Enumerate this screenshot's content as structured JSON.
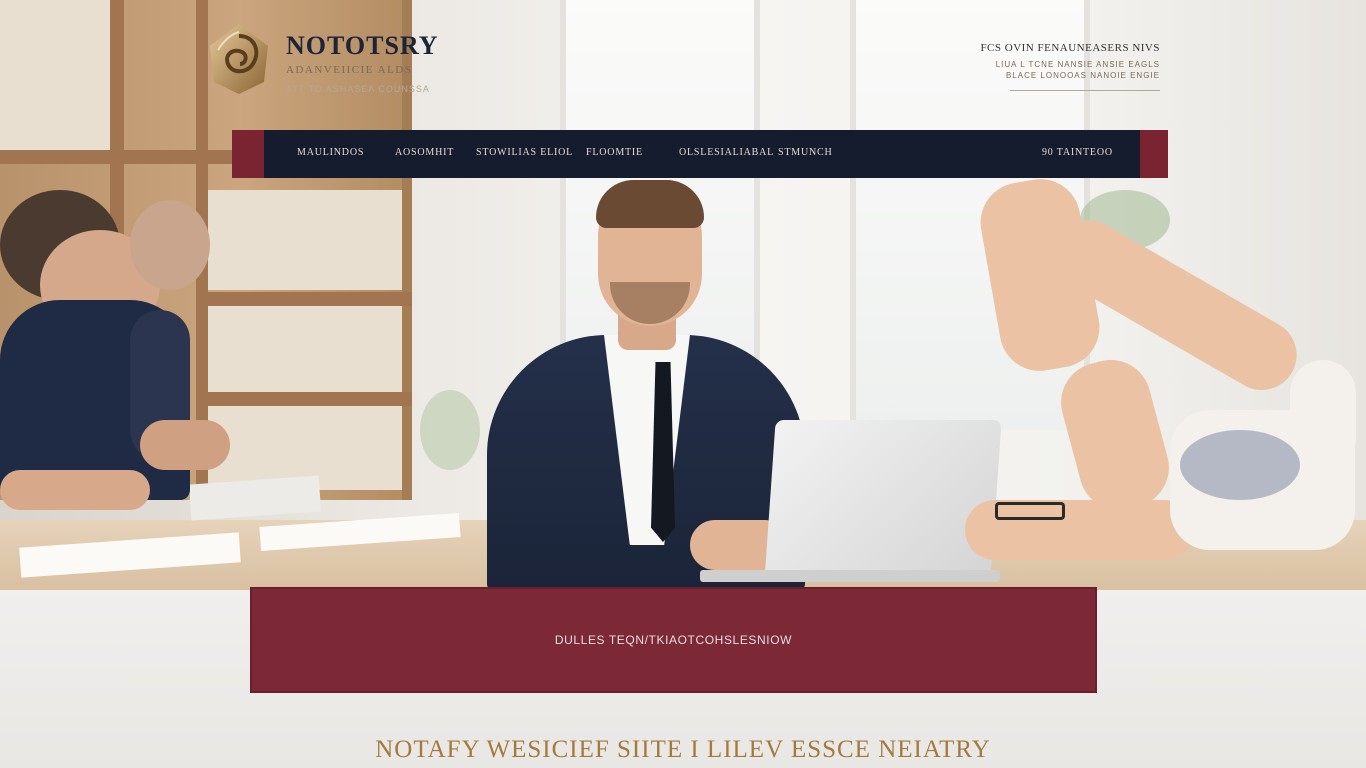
{
  "logo": {
    "name": "NOTOTSRY",
    "tagline": "ADANVEIICIE ALDS",
    "subtagline": "ATT TO ASHASEA COUNSSA"
  },
  "contact": {
    "line1": "FCS OVIN FENAUNEASERS NIVS",
    "line2": "LIUA L TCNE NANSIE ANSIE EAGLS",
    "line3": "BLACE LONOOAS NANOIE ENGIE"
  },
  "nav": {
    "items": [
      "MAULINDOS",
      "AOSOMHIT",
      "STOWILIAS ELIOL",
      "FLOOMTIE",
      "OLSLESIALIABAL",
      "STMUNCH"
    ],
    "cta": "90 TAINTEOO"
  },
  "banner": {
    "text": "DULLES TEQN/TKIAOTCOHSLESNIOW"
  },
  "footer": {
    "title": "NOTAFY WESICIEF SIITE I LILEV ESSCE NEIATRY"
  },
  "colors": {
    "nav_bg": "#151c2e",
    "accent_burgundy": "#7a2431",
    "gold": "#a37a3e"
  }
}
